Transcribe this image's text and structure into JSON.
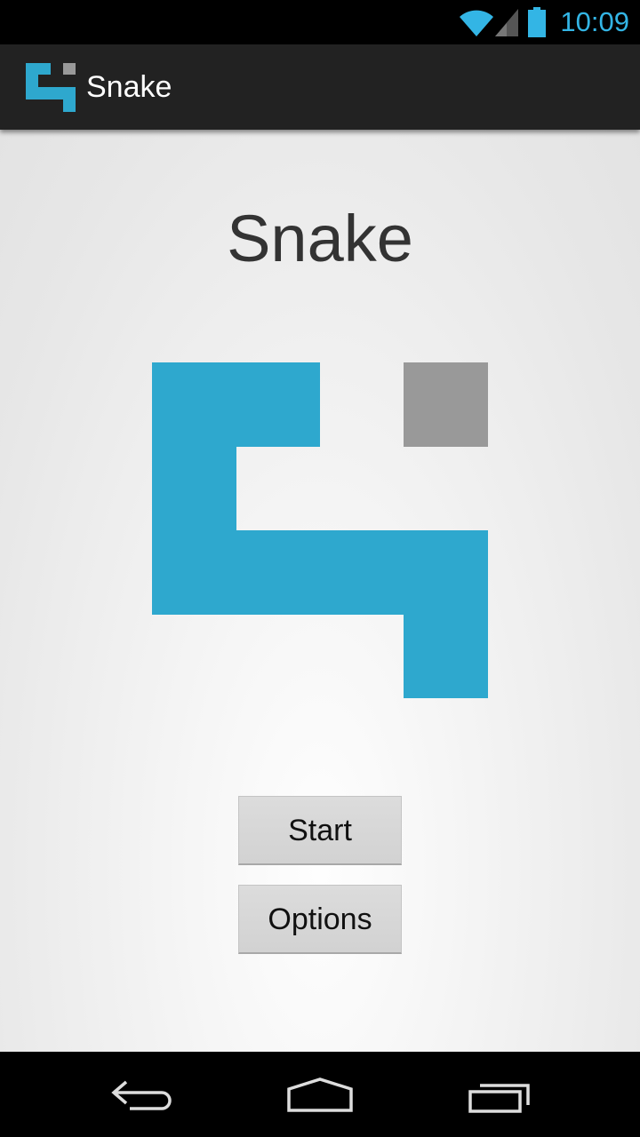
{
  "status_bar": {
    "time": "10:09",
    "icons": [
      "wifi-icon",
      "signal-icon",
      "battery-icon"
    ],
    "accent_color": "#33b5e5"
  },
  "action_bar": {
    "title": "Snake",
    "icon": "snake-logo-icon"
  },
  "main": {
    "title": "Snake",
    "logo": "snake-logo-icon",
    "snake_color": "#2ea8ce",
    "food_color": "#999999",
    "buttons": {
      "start_label": "Start",
      "options_label": "Options"
    }
  },
  "nav_bar": {
    "icons": [
      "back-icon",
      "home-icon",
      "recent-apps-icon"
    ]
  }
}
